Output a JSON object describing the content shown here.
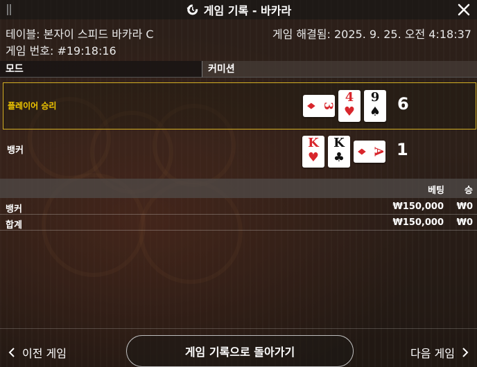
{
  "header": {
    "title": "게임 기록 - 바카라",
    "icon": "history-icon"
  },
  "info": {
    "table": "테이블: 본자이 스피드 바카라 C",
    "resolved": "게임 해결됨: 2025. 9. 25. 오전 4:18:37",
    "game_number": "게임 번호: #19:18:16"
  },
  "mode_bar": {
    "mode_label": "모드",
    "commission_label": "커미션"
  },
  "results": {
    "player": {
      "label": "플레이어 승리",
      "score": "6",
      "cards": [
        {
          "rank": "3",
          "suit": "♦",
          "color": "red",
          "rotated": true
        },
        {
          "rank": "4",
          "suit": "♥",
          "color": "red",
          "rotated": false
        },
        {
          "rank": "9",
          "suit": "♠",
          "color": "black",
          "rotated": false
        }
      ]
    },
    "banker": {
      "label": "뱅커",
      "score": "1",
      "cards": [
        {
          "rank": "K",
          "suit": "♥",
          "color": "red",
          "rotated": false
        },
        {
          "rank": "K",
          "suit": "♣",
          "color": "black",
          "rotated": false
        },
        {
          "rank": "A",
          "suit": "♦",
          "color": "red",
          "rotated": true
        }
      ]
    }
  },
  "bets": {
    "col_bet": "베팅",
    "col_win": "승",
    "rows": [
      {
        "name": "뱅커",
        "amount": "₩150,000",
        "win": "₩0"
      },
      {
        "name": "합계",
        "amount": "₩150,000",
        "win": "₩0"
      }
    ]
  },
  "footer": {
    "prev_label": "이전 게임",
    "back_label": "게임 기록으로 돌아가기",
    "next_label": "다음 게임"
  },
  "colors": {
    "accent_gold": "#d4b024",
    "player_label": "#f2c800",
    "card_red": "#d8262c"
  }
}
